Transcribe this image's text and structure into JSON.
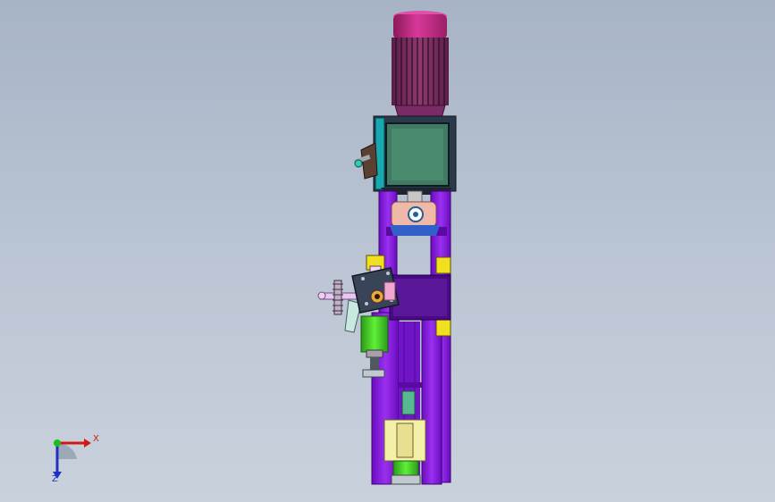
{
  "viewport": {
    "background_top": "#a7b4c6",
    "background_bottom": "#c9d1dc"
  },
  "model": {
    "colors": {
      "motor_cap": "#c0287e",
      "motor_fins": "#7a2e60",
      "gearbox_frame": "#1aa0a8",
      "gearbox_face": "#3f7a62",
      "frame": "#8a1fe0",
      "frame_dark": "#5a0aa0",
      "coupling": "#f0b8a8",
      "clamp_yellow": "#f0e020",
      "motor_green": "#48e028",
      "block_cream": "#f4f0a8",
      "handwheel": "#d0c0e8",
      "plate_dark": "#3a4458"
    }
  },
  "triad": {
    "x_label": "X",
    "z_label": "Z",
    "x_color": "#d01818",
    "y_color": "#18c018",
    "z_color": "#2030c0"
  }
}
